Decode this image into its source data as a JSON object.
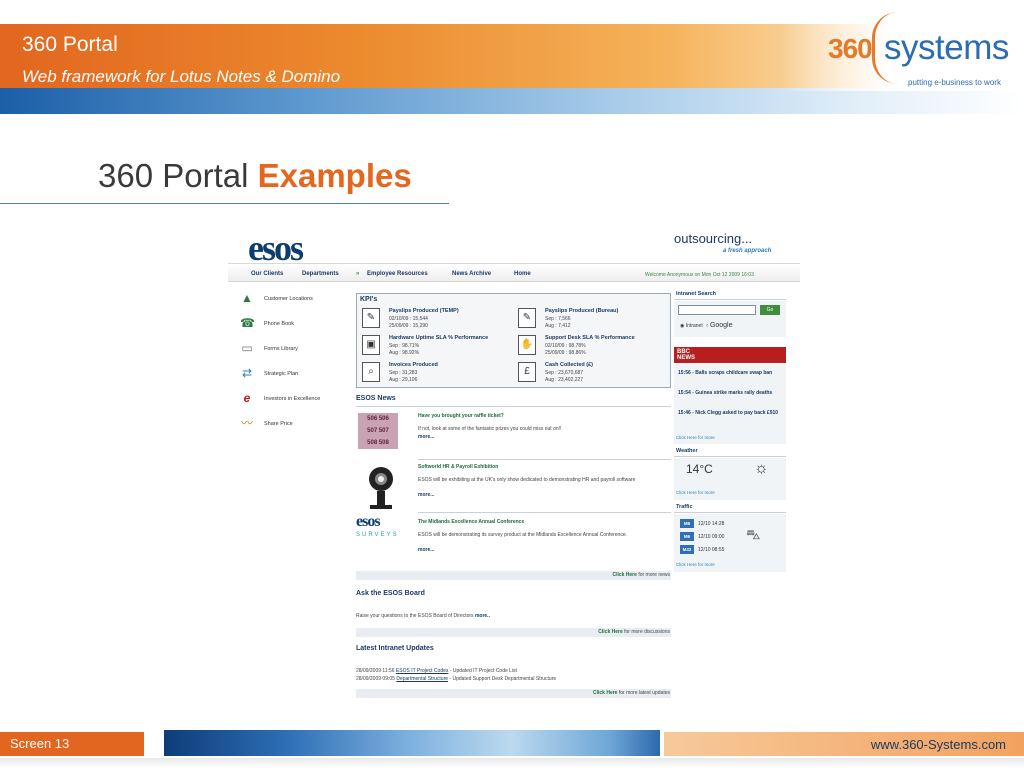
{
  "header": {
    "title": "360 Portal",
    "subtitle": "Web framework for Lotus Notes & Domino",
    "logo_prefix": "360",
    "logo_name": "systems",
    "tagline": "putting e-business to work"
  },
  "slide": {
    "title_plain": "360 Portal",
    "title_accent": "Examples"
  },
  "portal": {
    "brand": "esos",
    "outsourcing": "outsourcing...",
    "fresh": "a fresh approach",
    "nav": [
      "Our Clients",
      "Departments",
      "Employee Resources",
      "News Archive",
      "Home"
    ],
    "welcome": "Welcome Anonymous on Mon Oct 12 2009 16:03",
    "left_nav": [
      {
        "label": "Customer Locations",
        "icon": "uk-map-icon"
      },
      {
        "label": "Phone Book",
        "icon": "phone-icon"
      },
      {
        "label": "Forms Library",
        "icon": "document-icon"
      },
      {
        "label": "Strategic Plan",
        "icon": "arrows-icon"
      },
      {
        "label": "Investors in Excellence",
        "icon": "excellence-icon"
      },
      {
        "label": "Share Price",
        "icon": "chart-icon"
      }
    ],
    "kpi_heading": "KPI's",
    "kpis": [
      {
        "title": "Payslips Produced (TEMP)",
        "l1": "02/10/09 : 15,544",
        "l2": "25/09/09 : 15,290"
      },
      {
        "title": "Payslips Produced (Bureau)",
        "l1": "Sep : 7,566",
        "l2": "Aug : 7,412"
      },
      {
        "title": "Hardware Uptime SLA % Performance",
        "l1": "Sep : 98.71%",
        "l2": "Aug : 98.92%"
      },
      {
        "title": "Support Desk SLA % Performance",
        "l1": "02/10/09 : 98.78%",
        "l2": "25/09/09 : 98.86%"
      },
      {
        "title": "Invoices Produced",
        "l1": "Sep : 31,283",
        "l2": "Aug : 29,106"
      },
      {
        "title": "Cash Collected (£)",
        "l1": "Sep : 23,670,687",
        "l2": "Aug : 23,402,227"
      }
    ],
    "news_heading": "ESOS News",
    "raffle_numbers": [
      "506 506",
      "507 507",
      "508 508"
    ],
    "news": [
      {
        "title": "Have you brought your raffle ticket?",
        "body": "If not, look at some of the fantastic prizes you could miss out on!!",
        "more": "more..."
      },
      {
        "title": "Softworld HR & Payroll Exhibition",
        "body": "ESOS will be exhibiting at the UK's only show dedicated to demonstrating HR and payroll software",
        "more": "more..."
      },
      {
        "title": "The Midlands Excellence Annual Conference",
        "body": "ESOS will be demonstrating its survey product at the Midlands Excellence Annual Conference.",
        "more": "more..."
      }
    ],
    "surveys_brand": "esos",
    "surveys_sub": "SURVEYS",
    "news_more_link": "Click Here",
    "news_more_text": "for more news",
    "board_heading": "Ask the ESOS Board",
    "board_text": "Raise your questions to the ESOS Board of Directors",
    "board_more": "more..",
    "board_more_link": "Click Here",
    "board_more_text": "for more discussions",
    "updates_heading": "Latest Intranet Updates",
    "updates": [
      {
        "when": "28/09/2009 11:56",
        "link": "ESOS IT Project Codes",
        "text": "- Updated IT Project Code List"
      },
      {
        "when": "28/09/2009 09:05",
        "link": "Departmental Structure",
        "text": "- Updated Support Desk Departmental Structure"
      }
    ],
    "updates_more_link": "Click Here",
    "updates_more_text": "for more latest updates",
    "search_heading": "Intranet Search",
    "search_go": "Go",
    "radio_intranet": "Intranet",
    "radio_google": "Google",
    "bbc_label": "BBC",
    "bbc_news": "NEWS",
    "bbc_items": [
      "15:56 - Balls scraps childcare swap ban",
      "15:54 - Guinea strike marks rally deaths",
      "15:46 - Nick Clegg asked to pay back £910"
    ],
    "click_more": "Click Here for more",
    "weather_heading": "Weather",
    "temperature": "14°C",
    "traffic_heading": "Traffic",
    "traffic": [
      {
        "road": "M6",
        "time": "12/10 14:28"
      },
      {
        "road": "M6",
        "time": "12/10 09:00"
      },
      {
        "road": "M42",
        "time": "12/10 08:55"
      }
    ]
  },
  "footer": {
    "screen": "Screen 13",
    "url": "www.360-Systems.com"
  },
  "colors": {
    "orange": "#e2661f",
    "blue": "#2b6cb2",
    "navy": "#1a3a66",
    "green": "#1d6b3a",
    "bbc_red": "#b81e1e"
  }
}
